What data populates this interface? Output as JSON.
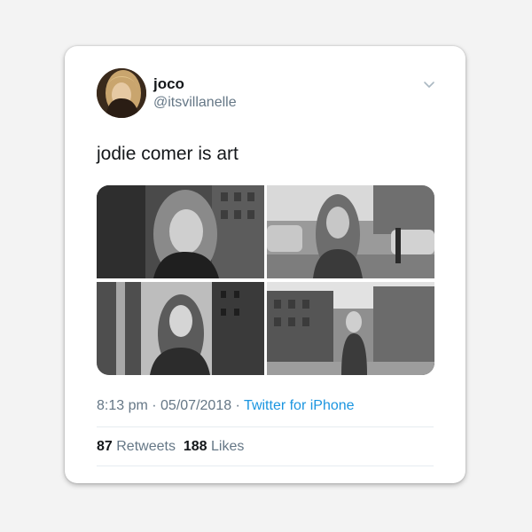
{
  "tweet": {
    "display_name": "joco",
    "handle": "@itsvillanelle",
    "text": "jodie comer is art",
    "time": "8:13 pm",
    "separator1": " · ",
    "date": "05/07/2018",
    "separator2": " · ",
    "source": "Twitter for iPhone",
    "retweets_count": "87",
    "retweets_label": "Retweets",
    "likes_count": "188",
    "likes_label": "Likes"
  },
  "colors": {
    "background": "#f3f3f3",
    "card": "#ffffff",
    "text_primary": "#14171a",
    "text_secondary": "#657786",
    "link": "#1b95e0",
    "divider": "#e6ecf0"
  },
  "icons": {
    "menu": "chevron-down-icon"
  },
  "media": [
    {
      "tone": "grayscale"
    },
    {
      "tone": "grayscale"
    },
    {
      "tone": "grayscale"
    },
    {
      "tone": "grayscale"
    }
  ]
}
